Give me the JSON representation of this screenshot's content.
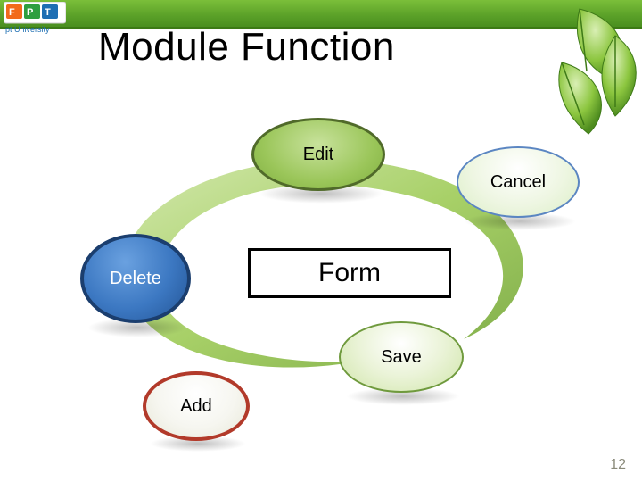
{
  "title": "Module Function",
  "logo_text": "pt University",
  "page_number": "12",
  "diagram": {
    "center_label": "Form",
    "nodes": {
      "edit": {
        "label": "Edit"
      },
      "cancel": {
        "label": "Cancel"
      },
      "delete": {
        "label": "Delete"
      },
      "save": {
        "label": "Save"
      },
      "add": {
        "label": "Add"
      }
    }
  },
  "colors": {
    "topbar": "#5aa028",
    "edit": "#9bc65a",
    "delete": "#3c78c2",
    "add_border": "#b23a2a",
    "cancel_border": "#5b86c2",
    "save_border": "#6f9a3d"
  }
}
